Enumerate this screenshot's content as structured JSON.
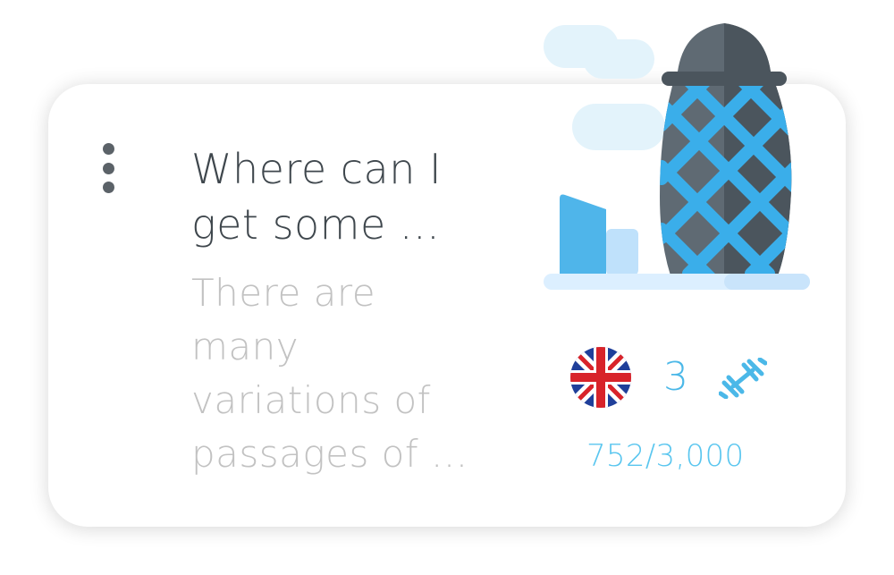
{
  "card": {
    "title": "Where can I get some ...",
    "description": "There are many variations of passages of ...",
    "language_icon": "uk-flag-icon",
    "count": "3",
    "count_icon": "dumbbell-icon",
    "progress": "752/3,000",
    "illustration": "london-gherkin-building",
    "accent_color": "#4bb8e8"
  }
}
